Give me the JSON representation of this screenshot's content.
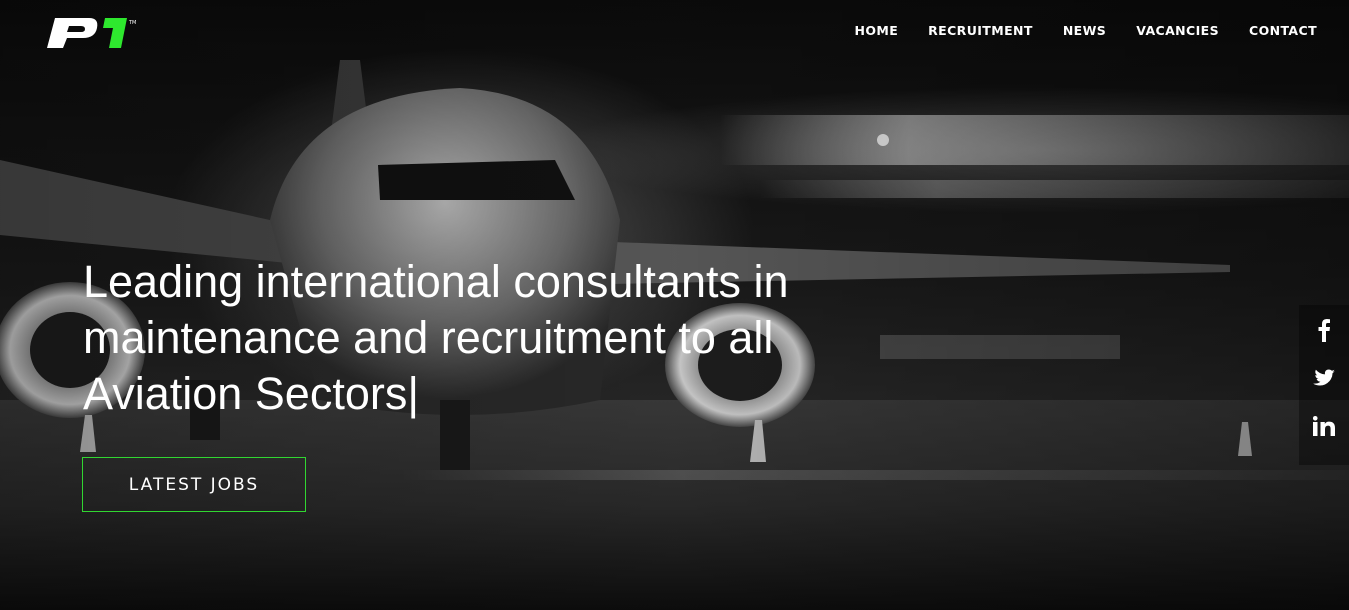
{
  "brand": {
    "logo_text": "P1",
    "logo_mark": "TM",
    "accent_color": "#2ee82e"
  },
  "nav": {
    "items": [
      {
        "label": "HOME"
      },
      {
        "label": "RECRUITMENT"
      },
      {
        "label": "NEWS"
      },
      {
        "label": "VACANCIES"
      },
      {
        "label": "CONTACT"
      }
    ]
  },
  "hero": {
    "headline": "Leading international consultants in maintenance and recruitment to all Aviation Sectors",
    "cursor": "|",
    "cta_label": "LATEST JOBS"
  },
  "social": {
    "icons": [
      "facebook-icon",
      "twitter-icon",
      "linkedin-icon"
    ]
  }
}
